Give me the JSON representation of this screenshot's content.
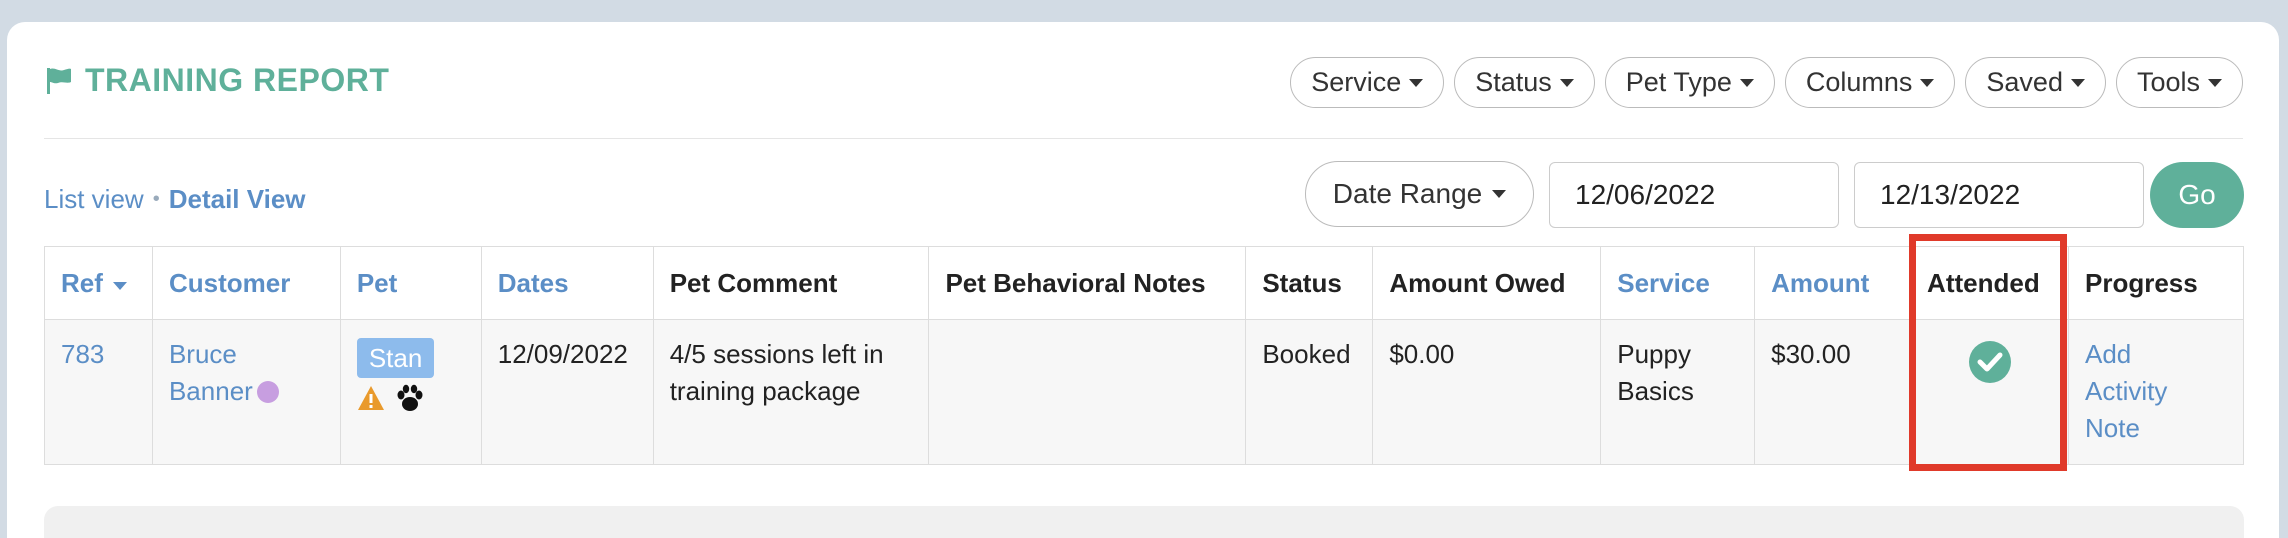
{
  "header": {
    "title": "TRAINING REPORT",
    "icon": "flag-icon",
    "accent": "#5fb09a"
  },
  "filters": [
    {
      "name": "filter-service",
      "label": "Service"
    },
    {
      "name": "filter-status",
      "label": "Status"
    },
    {
      "name": "filter-pet-type",
      "label": "Pet Type"
    },
    {
      "name": "filter-columns",
      "label": "Columns"
    },
    {
      "name": "filter-saved",
      "label": "Saved"
    },
    {
      "name": "filter-tools",
      "label": "Tools"
    }
  ],
  "views": {
    "list": "List view",
    "separator": "•",
    "detail": "Detail View"
  },
  "date": {
    "range_label": "Date Range",
    "start": "12/06/2022",
    "end": "12/13/2022",
    "go": "Go"
  },
  "table": {
    "headers": [
      "Ref",
      "Customer",
      "Pet",
      "Dates",
      "Pet Comment",
      "Pet Behavioral Notes",
      "Status",
      "Amount Owed",
      "Service",
      "Amount",
      "Attended",
      "Progress"
    ],
    "row": {
      "ref": "783",
      "customer_line1": "Bruce",
      "customer_line2": "Banner",
      "pet": "Stan",
      "dates": "12/09/2022",
      "comment_line1": "4/5 sessions left in",
      "comment_line2": "training package",
      "behavioral": "",
      "status": "Booked",
      "amount_owed": "$0.00",
      "service_line1": "Puppy",
      "service_line2": "Basics",
      "amount": "$30.00",
      "attended": "check-circle-icon",
      "progress_line1": "Add",
      "progress_line2": "Activity",
      "progress_line3": "Note"
    }
  },
  "colors": {
    "link": "#5b8ec6",
    "highlight": "#e03a2a",
    "pet_tag": "#8dbbec",
    "warning": "#e99a2c"
  }
}
